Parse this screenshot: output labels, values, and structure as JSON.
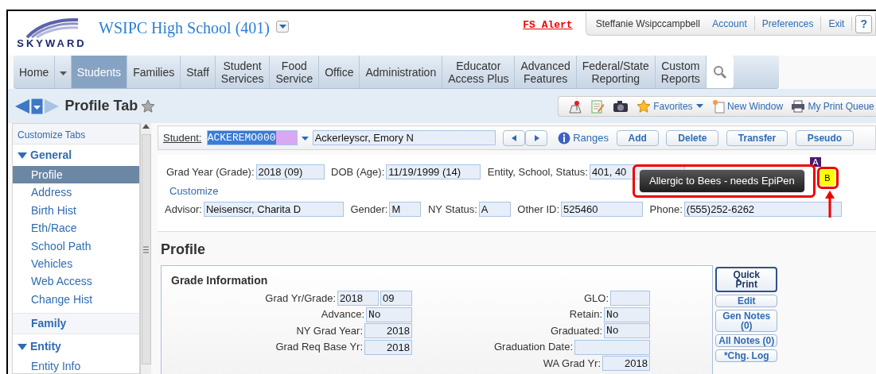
{
  "header": {
    "logo": "SKYWARD",
    "school": "WSIPC High School (401)",
    "alert": "FS Alert",
    "user": "Steffanie Wsipccampbell",
    "links": [
      "Account",
      "Preferences",
      "Exit"
    ],
    "help": "?"
  },
  "nav": [
    {
      "label": "Home",
      "selected": false,
      "menu": true
    },
    {
      "label": "Students",
      "selected": true
    },
    {
      "label": "Families",
      "selected": false
    },
    {
      "label": "Staff",
      "selected": false
    },
    {
      "label": "Student\nServices",
      "selected": false
    },
    {
      "label": "Food\nService",
      "selected": false
    },
    {
      "label": "Office",
      "selected": false
    },
    {
      "label": "Administration",
      "selected": false
    },
    {
      "label": "Educator\nAccess Plus",
      "selected": false
    },
    {
      "label": "Advanced\nFeatures",
      "selected": false
    },
    {
      "label": "Federal/State\nReporting",
      "selected": false
    },
    {
      "label": "Custom\nReports",
      "selected": false
    }
  ],
  "page_title": "Profile Tab",
  "toolbar": {
    "favorites": "Favorites",
    "new_window": "New Window",
    "print_queue": "My Print Queue"
  },
  "sidebar": {
    "header": "Customize Tabs",
    "groups": [
      {
        "label": "General",
        "expanded": true,
        "children": [
          {
            "label": "Profile",
            "selected": true
          },
          {
            "label": "Address",
            "selected": false
          },
          {
            "label": "Birth Hist",
            "selected": false
          },
          {
            "label": "Eth/Race",
            "selected": false
          },
          {
            "label": "School Path",
            "selected": false
          },
          {
            "label": "Vehicles",
            "selected": false
          },
          {
            "label": "Web Access",
            "selected": false
          },
          {
            "label": "Change Hist",
            "selected": false
          }
        ]
      },
      {
        "label": "Family",
        "expanded": false
      },
      {
        "label": "Entity",
        "expanded": true,
        "children": [
          {
            "label": "Entity Info",
            "selected": false
          }
        ]
      }
    ]
  },
  "student_bar": {
    "label": "Student:",
    "id": "ACKEREMO000",
    "name": "Ackerleyscr, Emory N",
    "ranges": "Ranges",
    "buttons": [
      "Add",
      "Delete",
      "Transfer",
      "Pseudo"
    ]
  },
  "info": {
    "row1": [
      {
        "label": "Grad Year (Grade):",
        "value": "2018 (09)"
      },
      {
        "label": "DOB (Age):",
        "value": "11/19/1999 (14)"
      },
      {
        "label": "Entity, School, Status:",
        "value": "401, 40"
      }
    ],
    "tooltip": "Allergic to Bees - needs EpiPen",
    "badges": [
      {
        "text": "A",
        "color": "#4b1a6b"
      },
      {
        "text": "B",
        "color": "#ffff00"
      }
    ],
    "customize": "Customize",
    "row2": [
      {
        "label": "Advisor:",
        "value": "Neisenscr, Charita D"
      },
      {
        "label": "Gender:",
        "value": "M"
      },
      {
        "label": "NY Status:",
        "value": "A"
      },
      {
        "label": "Other ID:",
        "value": "525460"
      },
      {
        "label": "Phone:",
        "value": "(555)252-6262"
      }
    ]
  },
  "profile": {
    "heading": "Profile",
    "section": "Grade Information",
    "left": [
      {
        "label": "Grad Yr/Grade:",
        "kind": "pair",
        "values": [
          "2018",
          "09"
        ]
      },
      {
        "label": "Advance:",
        "kind": "code",
        "value": "No"
      },
      {
        "label": "NY Grad Year:",
        "kind": "number",
        "value": "2018"
      },
      {
        "label": "Grad Req Base Yr:",
        "kind": "number",
        "value": "2018"
      }
    ],
    "right": [
      {
        "label": "GLO:",
        "kind": "text"
      },
      {
        "label": "Retain:",
        "kind": "code",
        "value": "No"
      },
      {
        "label": "Graduated:",
        "kind": "code",
        "value": "No"
      },
      {
        "label": "Graduation Date:",
        "kind": "wide"
      },
      {
        "label": "WA Grad Yr:",
        "kind": "number",
        "value": "2018"
      }
    ],
    "buttons": [
      {
        "label": "Quick\nPrint",
        "primary": true
      },
      {
        "label": "Edit",
        "primary": false
      },
      {
        "label": "Gen Notes\n(0)",
        "primary": false
      },
      {
        "label": "All Notes (0)",
        "primary": false
      },
      {
        "label": "*Chg. Log",
        "primary": false
      }
    ]
  }
}
